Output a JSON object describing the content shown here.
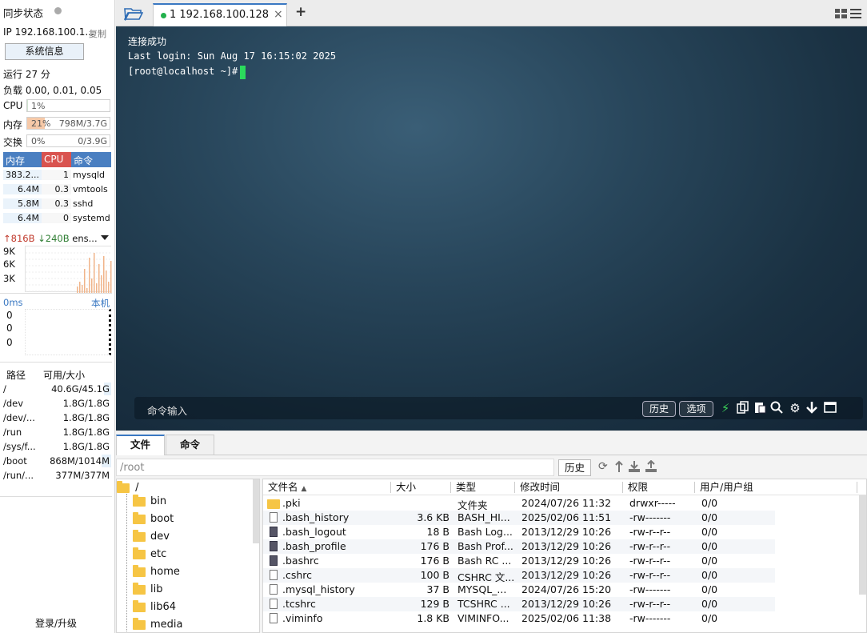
{
  "sidebar": {
    "sync_label": "同步状态",
    "ip_text": "IP 192.168.100.1...",
    "copy_label": "复制",
    "sysinfo_button": "系统信息",
    "uptime": "运行 27 分",
    "load": "负载 0.00, 0.01, 0.05",
    "cpu": {
      "label": "CPU",
      "value": "1%",
      "fill": 0.01
    },
    "mem": {
      "label": "内存",
      "value": "21%",
      "detail": "798M/3.7G",
      "fill": 0.21
    },
    "swap": {
      "label": "交换",
      "value": "0%",
      "detail": "0/3.9G",
      "fill": 0
    },
    "proc_headers": [
      "内存",
      "CPU",
      "命令"
    ],
    "processes": [
      {
        "mem": "383.2...",
        "cpu": "1",
        "cmd": "mysqld"
      },
      {
        "mem": "6.4M",
        "cpu": "0.3",
        "cmd": "vmtools"
      },
      {
        "mem": "5.8M",
        "cpu": "0.3",
        "cmd": "sshd"
      },
      {
        "mem": "6.4M",
        "cpu": "0",
        "cmd": "systemd"
      }
    ],
    "net": {
      "up": "816B",
      "down": "240B",
      "iface": "ens...",
      "ticks": [
        "9K",
        "6K",
        "3K"
      ],
      "up_color": "#c0392b",
      "down_color": "#2e7d32"
    },
    "latency": {
      "ms": "0ms",
      "host": "本机",
      "ticks": [
        "0",
        "0",
        "0"
      ]
    },
    "disk_headers": [
      "路径",
      "可用/大小"
    ],
    "disks": [
      {
        "path": "/",
        "value": "40.6G/45.1G",
        "used": 0.1
      },
      {
        "path": "/dev",
        "value": "1.8G/1.8G",
        "used": 0
      },
      {
        "path": "/dev/...",
        "value": "1.8G/1.8G",
        "used": 0
      },
      {
        "path": "/run",
        "value": "1.8G/1.8G",
        "used": 0
      },
      {
        "path": "/sys/f...",
        "value": "1.8G/1.8G",
        "used": 0
      },
      {
        "path": "/boot",
        "value": "868M/1014M",
        "used": 0.14
      },
      {
        "path": "/run/...",
        "value": "377M/377M",
        "used": 0
      }
    ],
    "login_label": "登录/升级"
  },
  "tabs": {
    "active_label": "1 192.168.100.128",
    "close": "×",
    "add": "+"
  },
  "terminal": {
    "lines": [
      "连接成功",
      "Last login: Sun Aug 17 16:15:02 2025",
      "[root@localhost ~]# "
    ],
    "cmd_placeholder": "命令输入",
    "history_button": "历史",
    "options_button": "选项"
  },
  "bottom": {
    "tabs": [
      "文件",
      "命令"
    ],
    "path": "/root",
    "history_button": "历史",
    "tree_root": "/",
    "tree_items": [
      "bin",
      "boot",
      "dev",
      "etc",
      "home",
      "lib",
      "lib64",
      "media"
    ],
    "columns": [
      "文件名",
      "大小",
      "类型",
      "修改时间",
      "权限",
      "用户/用户组"
    ],
    "files": [
      {
        "name": ".pki",
        "size": "",
        "type": "文件夹",
        "mtime": "2024/07/26 11:32",
        "perm": "drwxr-----",
        "owner": "0/0",
        "icon": "folder"
      },
      {
        "name": ".bash_history",
        "size": "3.6 KB",
        "type": "BASH_HI...",
        "mtime": "2025/02/06 11:51",
        "perm": "-rw-------",
        "owner": "0/0",
        "icon": "file"
      },
      {
        "name": ".bash_logout",
        "size": "18 B",
        "type": "Bash Log...",
        "mtime": "2013/12/29 10:26",
        "perm": "-rw-r--r--",
        "owner": "0/0",
        "icon": "dark"
      },
      {
        "name": ".bash_profile",
        "size": "176 B",
        "type": "Bash Prof...",
        "mtime": "2013/12/29 10:26",
        "perm": "-rw-r--r--",
        "owner": "0/0",
        "icon": "dark"
      },
      {
        "name": ".bashrc",
        "size": "176 B",
        "type": "Bash RC ...",
        "mtime": "2013/12/29 10:26",
        "perm": "-rw-r--r--",
        "owner": "0/0",
        "icon": "dark"
      },
      {
        "name": ".cshrc",
        "size": "100 B",
        "type": "CSHRC 文...",
        "mtime": "2013/12/29 10:26",
        "perm": "-rw-r--r--",
        "owner": "0/0",
        "icon": "file"
      },
      {
        "name": ".mysql_history",
        "size": "37 B",
        "type": "MYSQL_...",
        "mtime": "2024/07/26 15:20",
        "perm": "-rw-------",
        "owner": "0/0",
        "icon": "file"
      },
      {
        "name": ".tcshrc",
        "size": "129 B",
        "type": "TCSHRC ...",
        "mtime": "2013/12/29 10:26",
        "perm": "-rw-r--r--",
        "owner": "0/0",
        "icon": "file"
      },
      {
        "name": ".viminfo",
        "size": "1.8 KB",
        "type": "VIMINFO...",
        "mtime": "2025/02/06 11:38",
        "perm": "-rw-------",
        "owner": "0/0",
        "icon": "file"
      }
    ]
  }
}
